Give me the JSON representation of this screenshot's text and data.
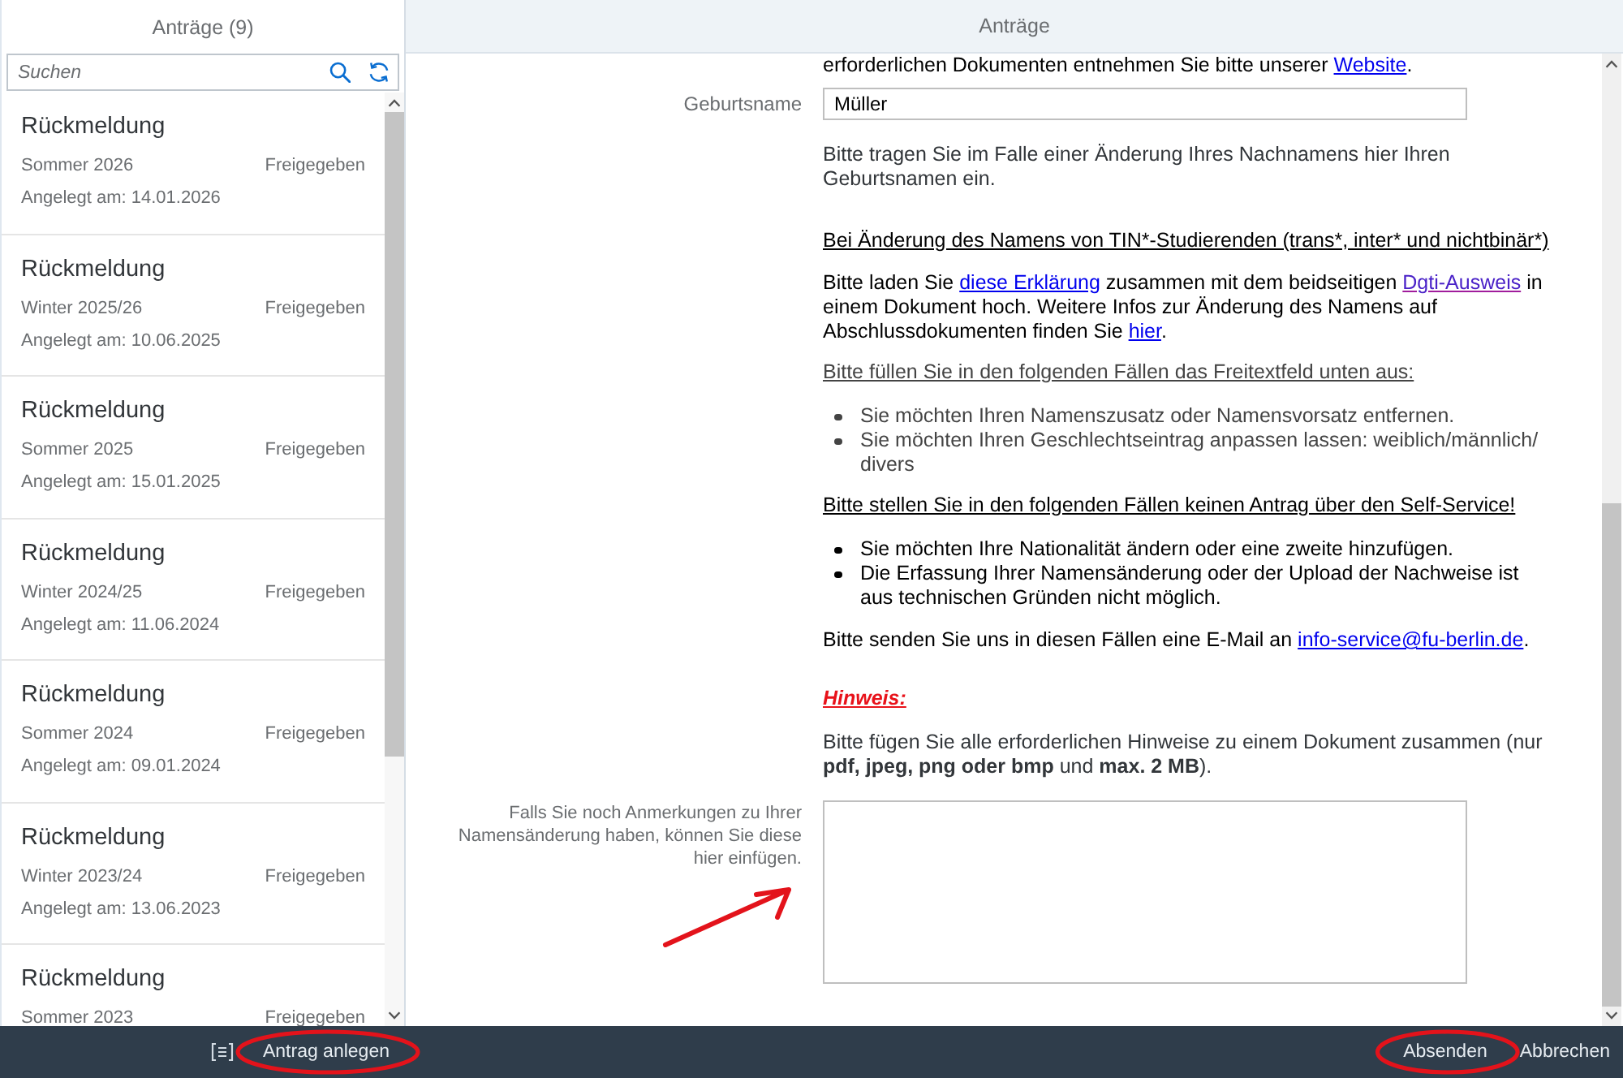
{
  "master": {
    "title": "Anträge (9)",
    "search": {
      "placeholder": "Suchen"
    },
    "items": [
      {
        "title": "Rückmeldung",
        "term": "Sommer 2026",
        "status": "Freigegeben",
        "created": "Angelegt am: 14.01.2026",
        "selected": false
      },
      {
        "title": "Rückmeldung",
        "term": "Winter 2025/26",
        "status": "Freigegeben",
        "created": "Angelegt am: 10.06.2025",
        "selected": false
      },
      {
        "title": "Rückmeldung",
        "term": "Sommer 2025",
        "status": "Freigegeben",
        "created": "Angelegt am: 15.01.2025",
        "selected": false
      },
      {
        "title": "Rückmeldung",
        "term": "Winter 2024/25",
        "status": "Freigegeben",
        "created": "Angelegt am: 11.06.2024",
        "selected": false
      },
      {
        "title": "Rückmeldung",
        "term": "Sommer 2024",
        "status": "Freigegeben",
        "created": "Angelegt am: 09.01.2024",
        "selected": false
      },
      {
        "title": "Rückmeldung",
        "term": "Winter 2023/24",
        "status": "Freigegeben",
        "created": "Angelegt am: 13.06.2023",
        "selected": false
      },
      {
        "title": "Rückmeldung",
        "term": "Sommer 2023",
        "status": "Freigegeben",
        "selected": false
      }
    ],
    "footer": {
      "buttons": [
        {
          "label": "Antrag anlegen",
          "circled": true
        }
      ]
    }
  },
  "detail": {
    "title": "Anträge",
    "blocks": [
      {
        "kind": "paragraph",
        "muted": false,
        "parts": [
          {
            "kind": "text",
            "text": "erforderlichen Dokumenten entnehmen Sie bitte unserer "
          },
          {
            "kind": "link",
            "text": "Website",
            "visited": false
          },
          {
            "kind": "text",
            "text": "."
          }
        ]
      },
      {
        "kind": "field",
        "label": "Geburtsname",
        "value": "Müller"
      },
      {
        "kind": "note",
        "text": "Bitte tragen Sie im Falle einer Änderung Ihres Nachnamens hier Ihren Geburtsnamen ein."
      },
      {
        "kind": "heading",
        "muted": false,
        "text": "Bei Änderung des Namens von TIN*-Studierenden (trans*, inter* und nichtbinär*)"
      },
      {
        "kind": "paragraph",
        "muted": false,
        "parts": [
          {
            "kind": "text",
            "text": "Bitte laden Sie "
          },
          {
            "kind": "link",
            "text": "diese Erklärung",
            "visited": false
          },
          {
            "kind": "text",
            "text": " zusammen mit dem beidseitigen "
          },
          {
            "kind": "link",
            "text": "Dgti-Ausweis",
            "visited": true
          },
          {
            "kind": "text",
            "text": " in einem Dokument hoch. Weitere Infos zur Änderung des Namens auf Abschlussdokumenten finden Sie "
          },
          {
            "kind": "link",
            "text": "hier",
            "visited": false
          },
          {
            "kind": "text",
            "text": "."
          }
        ]
      },
      {
        "kind": "heading",
        "muted": true,
        "text": "Bitte füllen Sie in den folgenden Fällen das Freitextfeld unten aus:"
      },
      {
        "kind": "bullets",
        "muted": true,
        "items": [
          "Sie möchten Ihren Namenszusatz oder Namensvorsatz entfernen.",
          "Sie möchten Ihren Geschlechtseintrag anpassen lassen: weiblich/männlich/ divers"
        ]
      },
      {
        "kind": "heading",
        "muted": false,
        "text": "Bitte stellen Sie in den folgenden Fällen keinen Antrag über den Self-Service!"
      },
      {
        "kind": "bullets",
        "muted": false,
        "items": [
          "Sie möchten Ihre Nationalität ändern oder eine zweite hinzufügen.",
          "Die Erfassung Ihrer Namensänderung oder der Upload der Nachweise ist aus technischen Gründen nicht möglich."
        ]
      },
      {
        "kind": "paragraph",
        "muted": false,
        "parts": [
          {
            "kind": "text",
            "text": "Bitte senden Sie uns in diesen Fällen eine E-Mail an "
          },
          {
            "kind": "link",
            "text": "info-service@fu-berlin.de",
            "visited": false
          },
          {
            "kind": "text",
            "text": "."
          }
        ]
      },
      {
        "kind": "warning",
        "text": "Hinweis:"
      },
      {
        "kind": "note",
        "text": "Bitte fügen Sie alle erforderlichen Hinweise zu einem Dokument zusammen (nur **pdf, jpeg, png oder bmp** und **max. 2 MB**)."
      },
      {
        "kind": "textarea",
        "label": "Falls Sie noch Anmerkungen zu Ihrer Namensänderung haben, können Sie diese hier einfügen.",
        "arrow": true
      }
    ],
    "footer": {
      "buttons": [
        {
          "label": "Absenden",
          "circled": true
        },
        {
          "label": "Abbrechen",
          "circled": false
        }
      ]
    }
  }
}
